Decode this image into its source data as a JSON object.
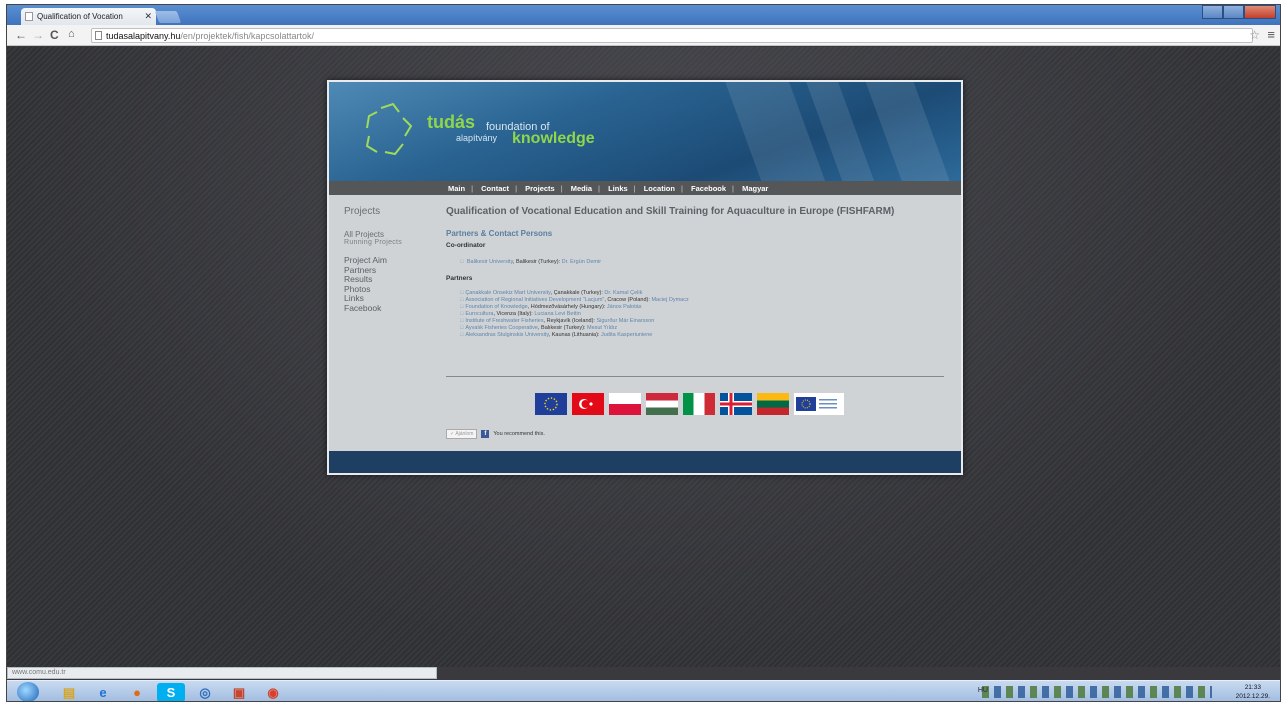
{
  "browser": {
    "tab_title": "Qualification of Vocation",
    "url_host": "tudasalapitvany.hu",
    "url_path": "/en/projektek/fish/kapcsolattartok/",
    "status_url": "www.comu.edu.tr"
  },
  "site": {
    "brand_tudas": "tudás",
    "brand_alapitvany": "alapítvány",
    "brand_foundation": "foundation of",
    "brand_knowledge": "knowledge",
    "nav": [
      "Main",
      "Contact",
      "Projects",
      "Media",
      "Links",
      "Location",
      "Facebook",
      "Magyar"
    ]
  },
  "sidebar": {
    "heading": "Projects",
    "all_projects": "All Projects",
    "running_projects": "Running Projects",
    "links": [
      "Project Aim",
      "Partners",
      "Results",
      "Photos",
      "Links",
      "Facebook"
    ]
  },
  "main": {
    "title": "Qualification of Vocational Education and Skill Training for Aquaculture in Europe (FISHFARM)",
    "section": "Partners & Contact Persons",
    "coordinator_heading": "Co-ordinator",
    "coordinator": {
      "org": "Balikesir University",
      "loc": ", Balikesir (Turkey): ",
      "person": "Dr. Ergün Demir"
    },
    "partners_heading": "Partners",
    "partners": [
      {
        "org": "Çanakkale Onsekiz Mart University",
        "loc": ", Çanakkale (Turkey): ",
        "person": "Dr. Kamal Çelik"
      },
      {
        "org": "Association of Regional Initiatives Development \"Lacjum\"",
        "loc": ", Cracow (Poland): ",
        "person": "Maciej Dymacz"
      },
      {
        "org": "Foundation of Knowledge",
        "loc": ", Hódmezővásárhely (Hungary): ",
        "person": "János Palotás"
      },
      {
        "org": "Eurocultura",
        "loc": ", Vicenza (Italy): ",
        "person": "Luciana Levi Bettin"
      },
      {
        "org": "Institute of Freshwater Fisheries",
        "loc": ", Reykjavík (Iceland): ",
        "person": "Sigurður Már Einarsson"
      },
      {
        "org": "Ayvalık Fisheries Cooperative",
        "loc": ", Balıkesir (Turkey): ",
        "person": "Mesut Yıldız"
      },
      {
        "org": "Aleksandras Stulginskis University",
        "loc": ", Kaunas (Lithuania): ",
        "person": "Judita Kasperiuniene"
      }
    ],
    "like_button": "Ajánlom",
    "like_text": "You recommend this."
  },
  "taskbar": {
    "lang": "HU",
    "time": "21:33",
    "date": "2012.12.29."
  },
  "colors": {
    "banner": "#1c4b75",
    "brand_green": "#8fd64a",
    "nav_bar": "#545658",
    "content_bg": "#cfd3d6",
    "footer": "#1e3f62"
  }
}
